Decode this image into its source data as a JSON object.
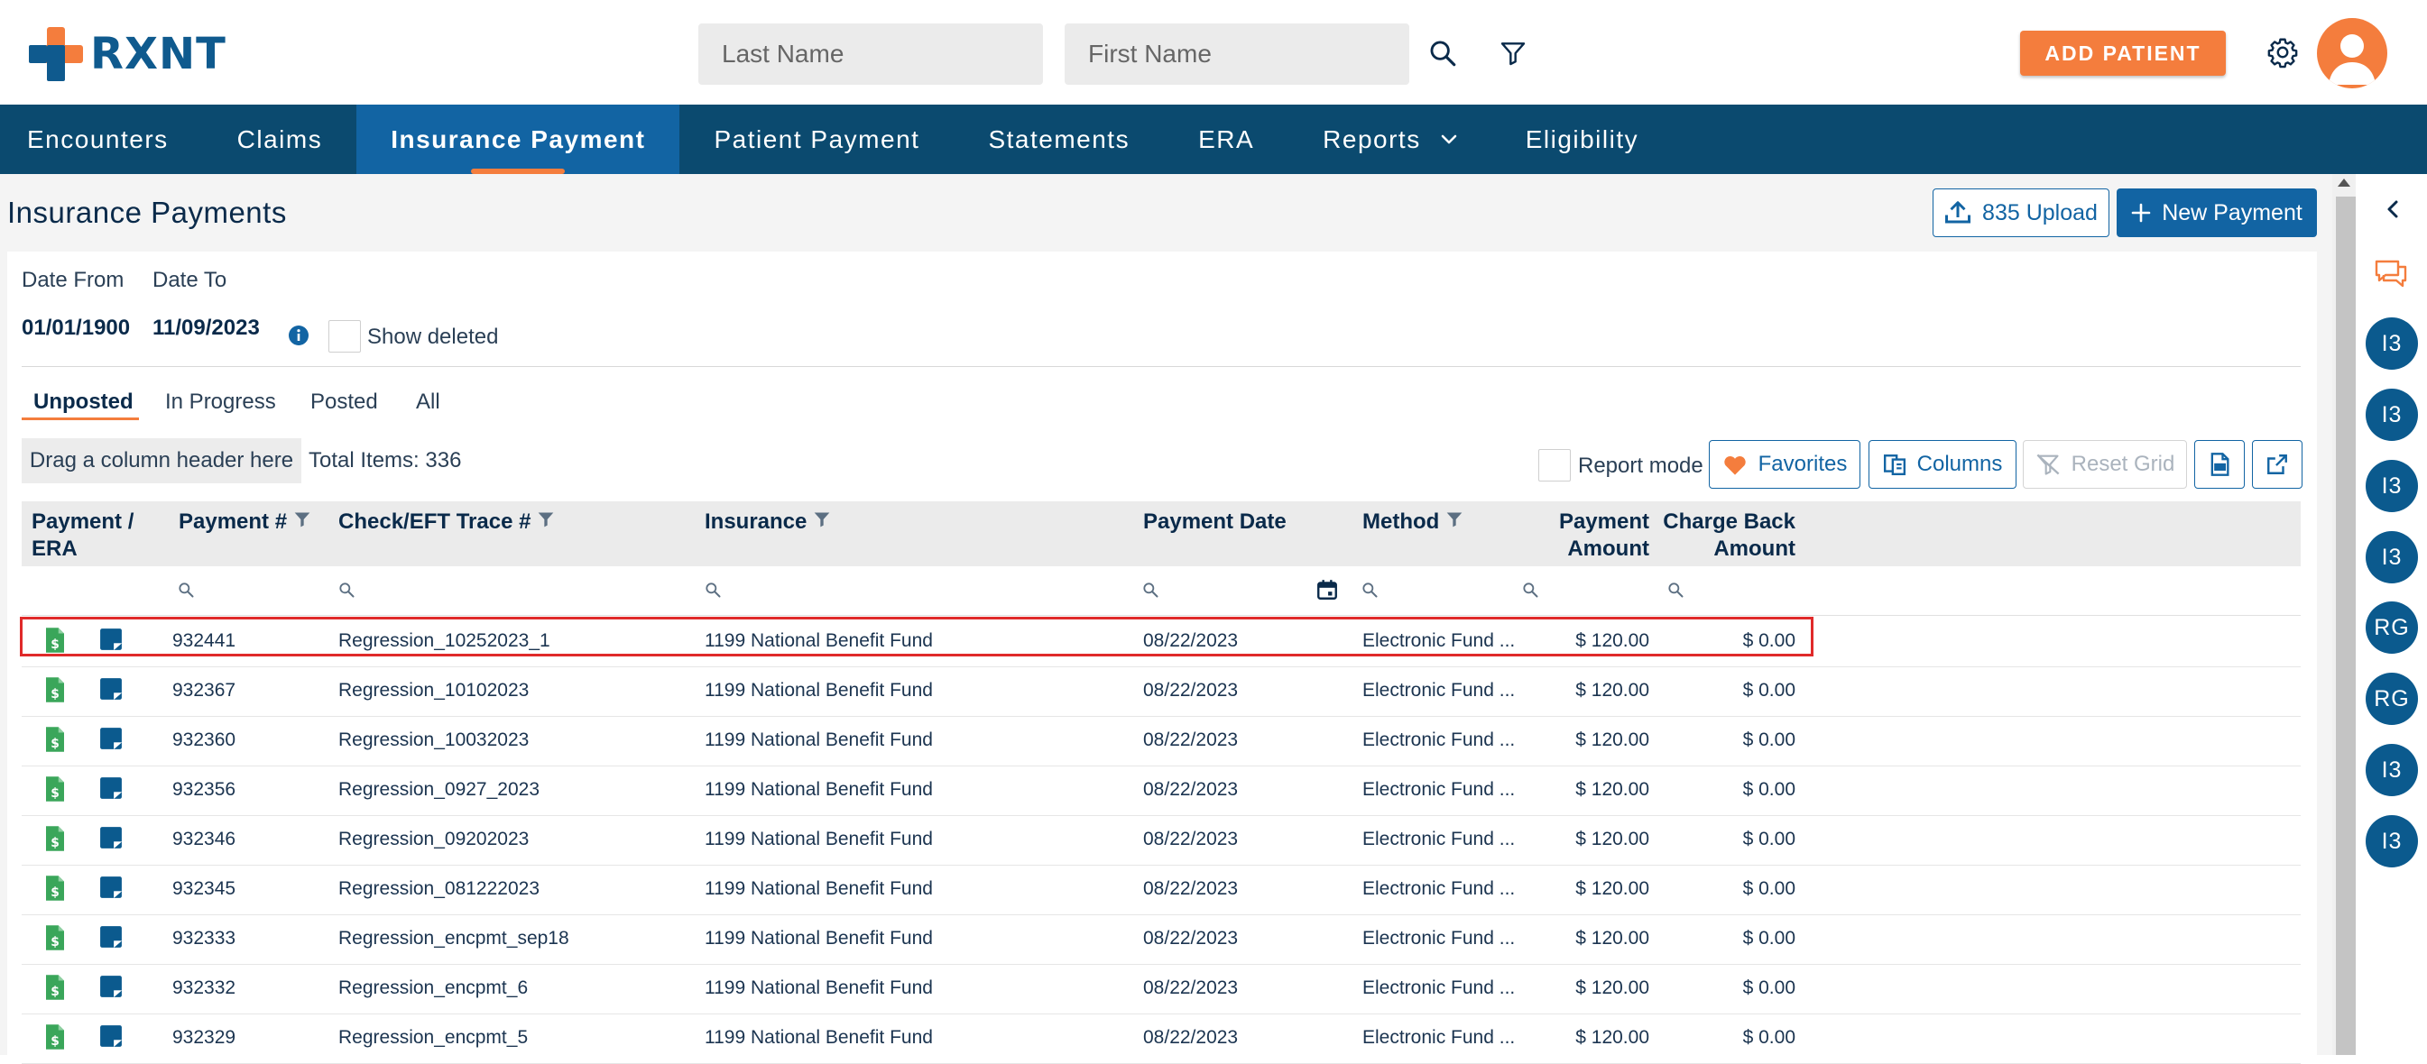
{
  "brand": {
    "name": "RXNT"
  },
  "search": {
    "last_name_placeholder": "Last Name",
    "first_name_placeholder": "First Name"
  },
  "header": {
    "add_patient_label": "ADD PATIENT"
  },
  "nav": {
    "items": [
      {
        "label": "Encounters"
      },
      {
        "label": "Claims"
      },
      {
        "label": "Insurance Payment",
        "active": true
      },
      {
        "label": "Patient Payment"
      },
      {
        "label": "Statements"
      },
      {
        "label": "ERA"
      },
      {
        "label": "Reports"
      },
      {
        "label": "Eligibility"
      }
    ]
  },
  "page": {
    "title": "Insurance Payments",
    "upload_label": "835 Upload",
    "new_payment_label": "New Payment"
  },
  "filters": {
    "date_from_label": "Date From",
    "date_to_label": "Date To",
    "date_from_value": "01/01/1900",
    "date_to_value": "11/09/2023",
    "show_deleted_label": "Show deleted"
  },
  "tabs": [
    {
      "label": "Unposted",
      "active": true
    },
    {
      "label": "In Progress"
    },
    {
      "label": "Posted"
    },
    {
      "label": "All"
    }
  ],
  "toolbar": {
    "drag_hint": "Drag a column header here",
    "total_items": "Total Items: 336",
    "report_mode_label": "Report mode",
    "favorites_label": "Favorites",
    "columns_label": "Columns",
    "reset_grid_label": "Reset Grid"
  },
  "grid": {
    "columns": {
      "payment_era_1": "Payment /",
      "payment_era_2": "ERA",
      "payment_no": "Payment #",
      "check_trace": "Check/EFT Trace #",
      "insurance": "Insurance",
      "payment_date": "Payment Date",
      "method": "Method",
      "payment_amount_1": "Payment",
      "payment_amount_2": "Amount",
      "charge_back_1": "Charge Back",
      "charge_back_2": "Amount"
    },
    "rows": [
      {
        "payment_no": "932441",
        "trace": "Regression_10252023_1",
        "insurance": "1199 National Benefit Fund",
        "date": "08/22/2023",
        "method": "Electronic Fund ...",
        "amount": "$ 120.00",
        "charge_back": "$ 0.00",
        "highlighted": true
      },
      {
        "payment_no": "932367",
        "trace": "Regression_10102023",
        "insurance": "1199 National Benefit Fund",
        "date": "08/22/2023",
        "method": "Electronic Fund ...",
        "amount": "$ 120.00",
        "charge_back": "$ 0.00"
      },
      {
        "payment_no": "932360",
        "trace": "Regression_10032023",
        "insurance": "1199 National Benefit Fund",
        "date": "08/22/2023",
        "method": "Electronic Fund ...",
        "amount": "$ 120.00",
        "charge_back": "$ 0.00"
      },
      {
        "payment_no": "932356",
        "trace": "Regression_0927_2023",
        "insurance": "1199 National Benefit Fund",
        "date": "08/22/2023",
        "method": "Electronic Fund ...",
        "amount": "$ 120.00",
        "charge_back": "$ 0.00"
      },
      {
        "payment_no": "932346",
        "trace": "Regression_09202023",
        "insurance": "1199 National Benefit Fund",
        "date": "08/22/2023",
        "method": "Electronic Fund ...",
        "amount": "$ 120.00",
        "charge_back": "$ 0.00"
      },
      {
        "payment_no": "932345",
        "trace": "Regression_081222023",
        "insurance": "1199 National Benefit Fund",
        "date": "08/22/2023",
        "method": "Electronic Fund ...",
        "amount": "$ 120.00",
        "charge_back": "$ 0.00"
      },
      {
        "payment_no": "932333",
        "trace": "Regression_encpmt_sep18",
        "insurance": "1199 National Benefit Fund",
        "date": "08/22/2023",
        "method": "Electronic Fund ...",
        "amount": "$ 120.00",
        "charge_back": "$ 0.00"
      },
      {
        "payment_no": "932332",
        "trace": "Regression_encpmt_6",
        "insurance": "1199 National Benefit Fund",
        "date": "08/22/2023",
        "method": "Electronic Fund ...",
        "amount": "$ 120.00",
        "charge_back": "$ 0.00"
      },
      {
        "payment_no": "932329",
        "trace": "Regression_encpmt_5",
        "insurance": "1199 National Benefit Fund",
        "date": "08/22/2023",
        "method": "Electronic Fund ...",
        "amount": "$ 120.00",
        "charge_back": "$ 0.00"
      }
    ]
  },
  "rail": {
    "badges": [
      "I3",
      "I3",
      "I3",
      "I3",
      "RG",
      "RG",
      "I3",
      "I3"
    ]
  },
  "colors": {
    "brand_blue": "#0f5a8e",
    "nav_bg": "#0b4a6f",
    "nav_active": "#1264a3",
    "accent_orange": "#f47d3d",
    "highlight_red": "#e02a2a",
    "payment_green": "#3aa65a"
  },
  "icons": {
    "search": "search-icon",
    "filter": "filter-icon",
    "settings": "gear-icon",
    "upload": "upload-icon",
    "plus": "plus-icon",
    "info": "info-icon",
    "heart": "heart-icon",
    "columns": "columns-icon",
    "reset": "reset-filter-icon",
    "csv": "csv-export-icon",
    "export": "export-icon",
    "collapse": "chevron-left-icon",
    "chat": "chat-icon",
    "calendar": "calendar-icon"
  }
}
